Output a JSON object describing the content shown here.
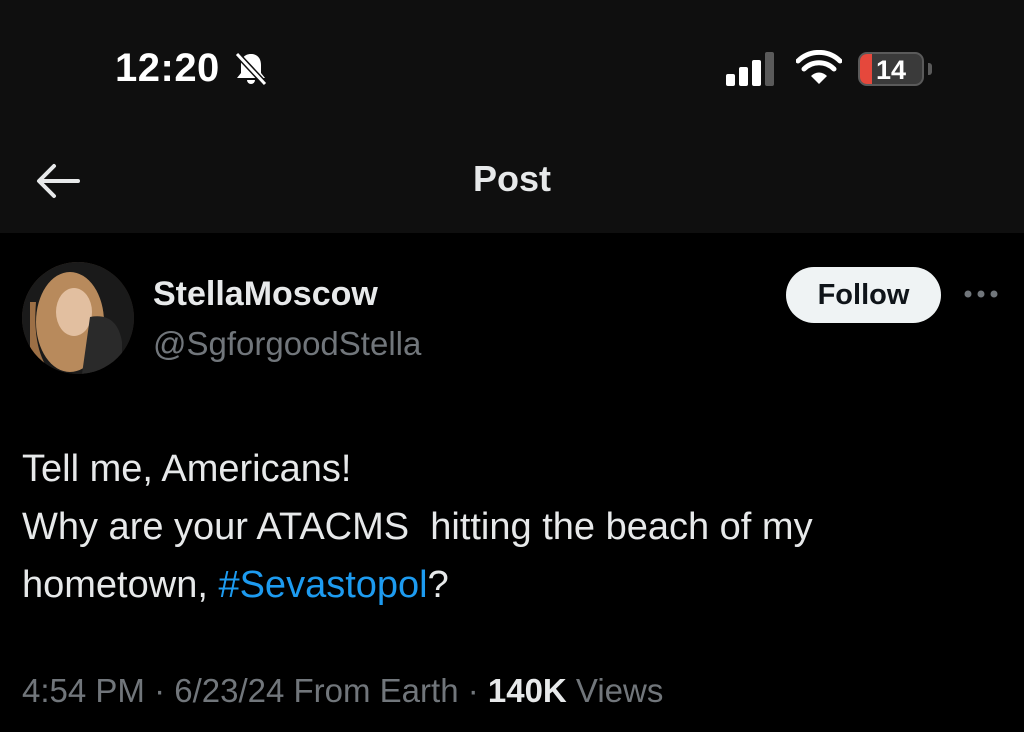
{
  "status_bar": {
    "time": "12:20",
    "battery_level": "14"
  },
  "nav": {
    "title": "Post"
  },
  "author": {
    "display_name": "StellaMoscow",
    "handle": "@SgforgoodStella",
    "follow_label": "Follow"
  },
  "post": {
    "line1": "Tell me, Americans!",
    "line2": "Why are your ATACMS  hitting the beach of my",
    "line3_prefix": "hometown, ",
    "hashtag": "#Sevastopol",
    "line3_suffix": "?"
  },
  "meta": {
    "time": "4:54 PM",
    "sep1": " · ",
    "date": "6/23/24",
    "source": " From Earth",
    "sep2": " · ",
    "views_count": "140K",
    "views_label": " Views"
  },
  "colors": {
    "background": "#000000",
    "header_background": "#0f0f0f",
    "text_primary": "#e7e9ea",
    "text_secondary": "#71767b",
    "link": "#1d9bf0",
    "battery_low": "#e5483c"
  },
  "icons": {
    "mute": "bell-slash-icon",
    "signal": "cellular-signal-icon",
    "wifi": "wifi-icon",
    "back": "arrow-left-icon",
    "more": "ellipsis-icon"
  }
}
